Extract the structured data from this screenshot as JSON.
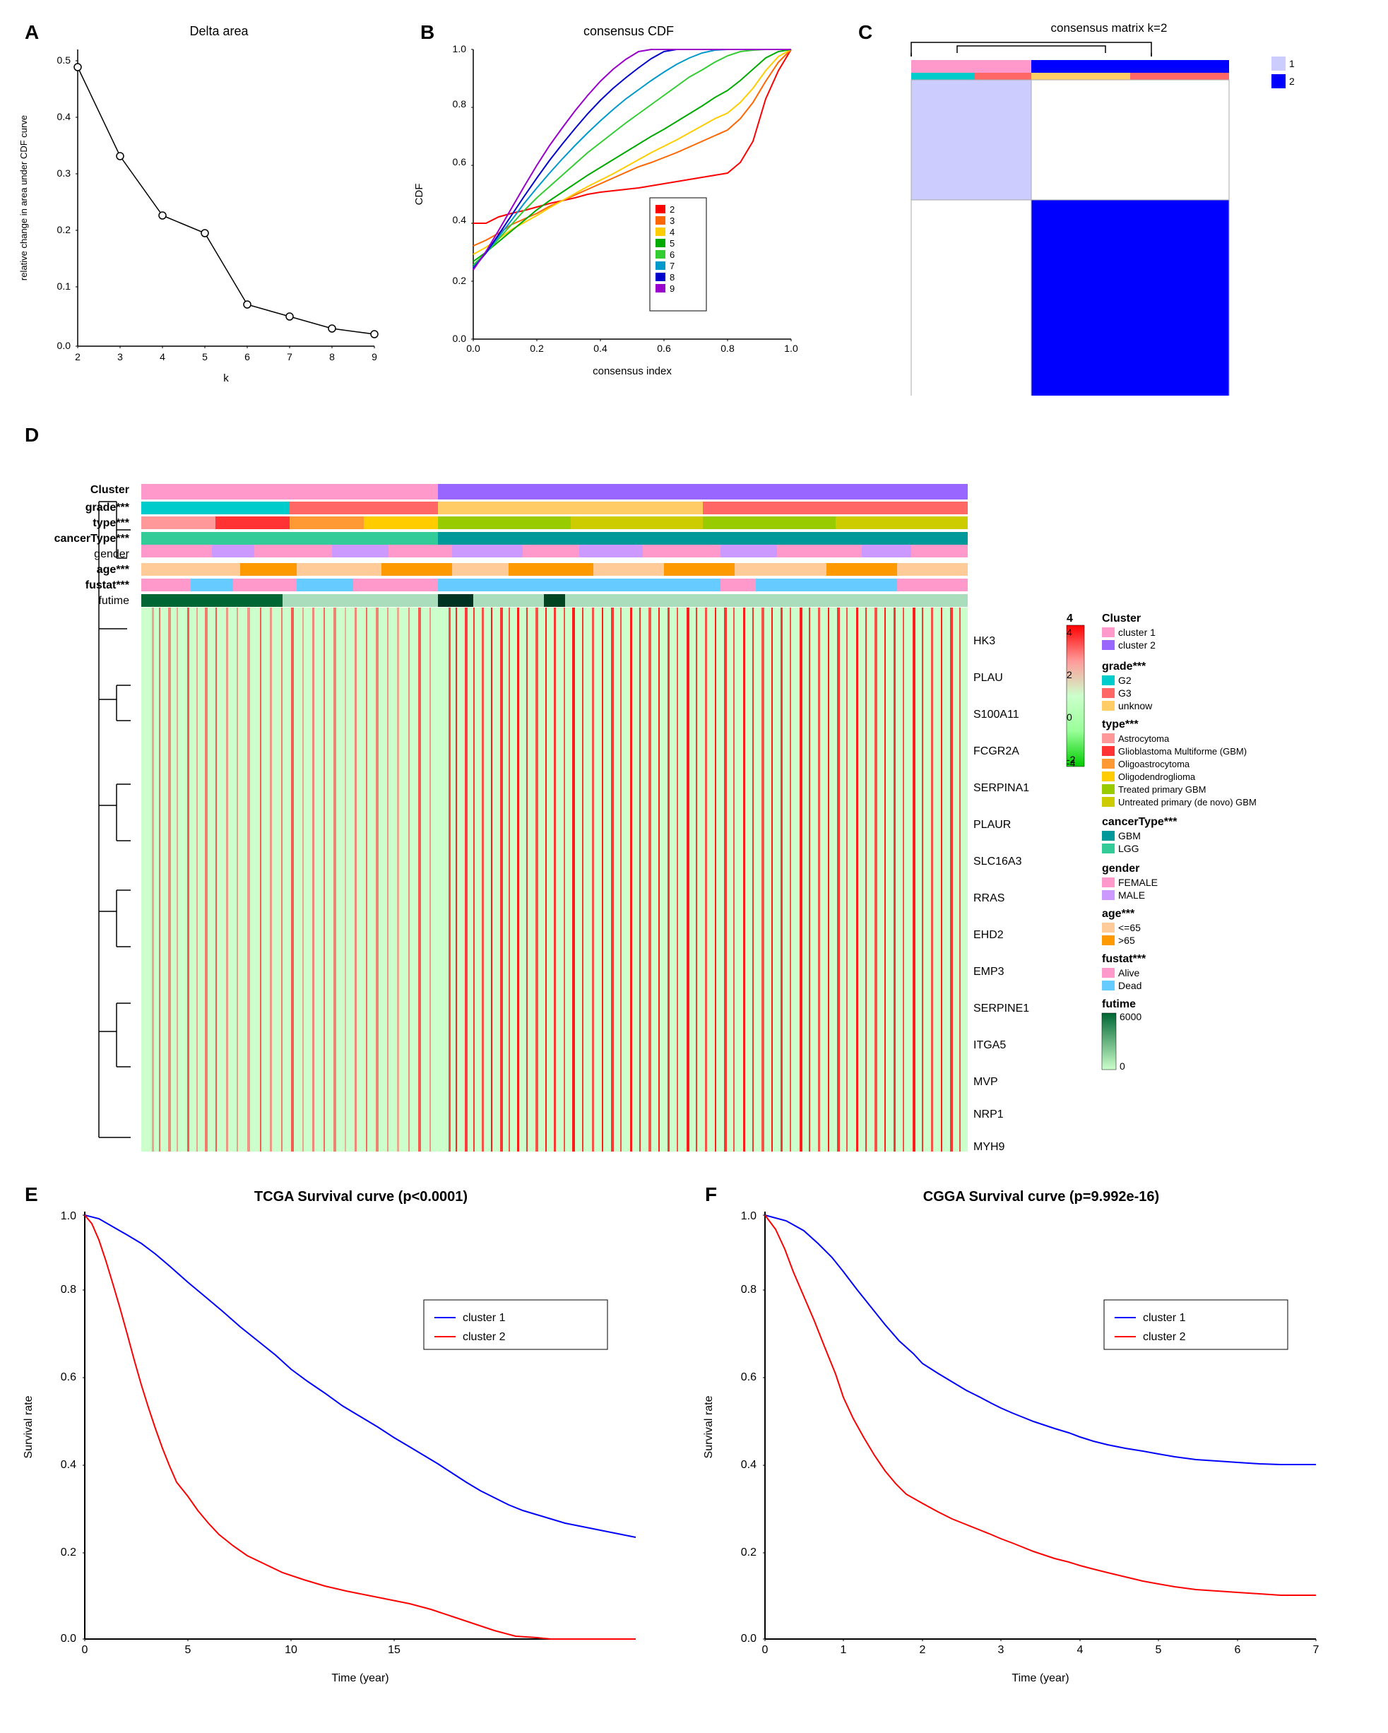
{
  "panels": {
    "A": {
      "label": "A",
      "title": "Delta area",
      "xLabel": "k",
      "yLabel": "relative change in area under CDF curve",
      "points": [
        {
          "x": 2,
          "y": 0.47
        },
        {
          "x": 3,
          "y": 0.32
        },
        {
          "x": 4,
          "y": 0.22
        },
        {
          "x": 5,
          "y": 0.19
        },
        {
          "x": 6,
          "y": 0.07
        },
        {
          "x": 7,
          "y": 0.05
        },
        {
          "x": 8,
          "y": 0.03
        },
        {
          "x": 9,
          "y": 0.02
        }
      ]
    },
    "B": {
      "label": "B",
      "title": "consensus CDF",
      "xLabel": "consensus index",
      "yLabel": "CDF",
      "legendItems": [
        {
          "k": "2",
          "color": "#FF0000"
        },
        {
          "k": "3",
          "color": "#FF6600"
        },
        {
          "k": "4",
          "color": "#FFCC00"
        },
        {
          "k": "5",
          "color": "#00AA00"
        },
        {
          "k": "6",
          "color": "#00CCCC"
        },
        {
          "k": "7",
          "color": "#0000FF"
        },
        {
          "k": "8",
          "color": "#6600CC"
        },
        {
          "k": "9",
          "color": "#CC00CC"
        }
      ]
    },
    "C": {
      "label": "C",
      "title": "consensus matrix k=2",
      "legendItems": [
        {
          "label": "1",
          "color": "#CCCCFF"
        },
        {
          "label": "2",
          "color": "#0000FF"
        }
      ]
    },
    "D": {
      "label": "D",
      "annotations": [
        "Cluster",
        "grade***",
        "type***",
        "cancerType***",
        "gender",
        "age***",
        "fustat***",
        "futime"
      ],
      "genes": [
        "HK3",
        "PLAU",
        "S100A11",
        "FCGR2A",
        "SERPINA1",
        "PLAUR",
        "SLC16A3",
        "RRAS",
        "EHD2",
        "EMP3",
        "SERPINE1",
        "ITGA5",
        "MVP",
        "NRP1",
        "MYH9"
      ],
      "legend": {
        "Cluster": {
          "items": [
            {
              "label": "cluster 1",
              "color": "#FF6699"
            },
            {
              "label": "cluster 2",
              "color": "#FF6699"
            }
          ]
        },
        "grade": {
          "title": "grade***",
          "items": [
            {
              "label": "G2",
              "color": "#00CCCC"
            },
            {
              "label": "G3",
              "color": "#FF6666"
            },
            {
              "label": "unknow",
              "color": "#FFCC66"
            }
          ]
        },
        "type": {
          "title": "type***",
          "items": [
            {
              "label": "Astrocytoma",
              "color": "#FF9999"
            },
            {
              "label": "Glioblastoma Multiforme (GBM)",
              "color": "#FF3333"
            },
            {
              "label": "Oligoastrocytoma",
              "color": "#FF9933"
            },
            {
              "label": "Oligodendroglioma",
              "color": "#FFCC00"
            },
            {
              "label": "Treated primary GBM",
              "color": "#99CC00"
            },
            {
              "label": "Untreated primary (de novo) GBM",
              "color": "#CCCC00"
            }
          ]
        },
        "cancerType": {
          "title": "cancerType***",
          "items": [
            {
              "label": "GBM",
              "color": "#009999"
            },
            {
              "label": "LGG",
              "color": "#33CC99"
            }
          ]
        },
        "gender": {
          "items": [
            {
              "label": "FEMALE",
              "color": "#FF99CC"
            },
            {
              "label": "MALE",
              "color": "#CC99FF"
            }
          ]
        },
        "age": {
          "title": "age***",
          "items": [
            {
              "label": "<=65",
              "color": "#FFCC99"
            },
            {
              "label": ">65",
              "color": "#FF9900"
            }
          ]
        },
        "fustat": {
          "title": "fustat***",
          "items": [
            {
              "label": "Alive",
              "color": "#FF99CC"
            },
            {
              "label": "Dead",
              "color": "#66CCFF"
            }
          ]
        },
        "futime": {
          "items": [
            {
              "label": "6000",
              "color": "#006633"
            },
            {
              "label": "0",
              "color": "#CCFFCC"
            }
          ]
        }
      }
    },
    "E": {
      "label": "E",
      "title": "TCGA Survival curve (p<0.0001)",
      "xLabel": "Time (year)",
      "yLabel": "Survival rate",
      "legendItems": [
        {
          "label": "cluster 1",
          "color": "#0000FF"
        },
        {
          "label": "cluster 2",
          "color": "#FF0000"
        }
      ]
    },
    "F": {
      "label": "F",
      "title": "CGGA Survival curve (p=9.992e-16)",
      "xLabel": "Time (year)",
      "yLabel": "Survival rate",
      "legendItems": [
        {
          "label": "cluster 1",
          "color": "#0000FF"
        },
        {
          "label": "cluster 2",
          "color": "#FF0000"
        }
      ]
    }
  }
}
